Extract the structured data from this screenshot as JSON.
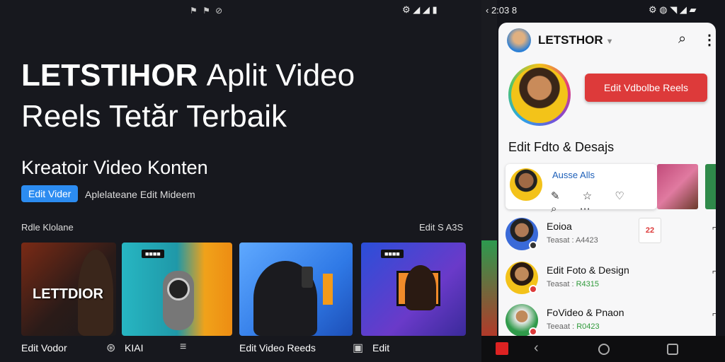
{
  "left_panel": {
    "status_icons": "⚑ ⚑ ⊘",
    "status_right": "⚙ ◢ ◢ ▮",
    "headline_bold": "LETSTIHOR",
    "headline_light": "Aplit Video",
    "headline_line2": "Reels Tetăr Terbaik",
    "subheadline": "Kreatoir Video Konten",
    "pill_label": "Edit Vider",
    "pill_text": "Aplelateane Edit Mideem",
    "section_left": "Rdle Klolane",
    "section_right": "Edit S A3S",
    "thumbs": [
      {
        "overlay": "LETTDIOR",
        "badge": ""
      },
      {
        "overlay": "",
        "badge": "■■■■"
      },
      {
        "overlay": "",
        "badge": ""
      },
      {
        "overlay": "",
        "badge": "■■■■"
      }
    ],
    "captions": [
      "Edit Vodor",
      "KIAI",
      "Edit Video Reeds",
      "Edit"
    ]
  },
  "phone": {
    "status_left": "‹ 2:03 8",
    "status_right": "⚙ ◍ ◥ ◢ ▰",
    "app_title": "LETSTHOR",
    "cta_label": "Edit Vdbolbe Reels",
    "section_title": "Edit Fdto & Desajs",
    "card_title": "Ausse Alls",
    "card_icons": "✎ ☆ ♡ ⌕ ⋯",
    "chats": [
      {
        "name": "Eoioa",
        "sub": "Teasat : A4423",
        "sub_hi": "",
        "thumb": "22"
      },
      {
        "name": "Edit Foto & Design",
        "sub": "Teasat : ",
        "sub_hi": "R4315",
        "thumb": ""
      },
      {
        "name": "FoVideo & Pnaon",
        "sub": "Teeaat : ",
        "sub_hi": "R0423",
        "thumb": ""
      }
    ]
  },
  "colors": {
    "accent_blue": "#2c8cf1",
    "cta_red": "#dd3a3a",
    "dark_bg": "#17181e"
  }
}
